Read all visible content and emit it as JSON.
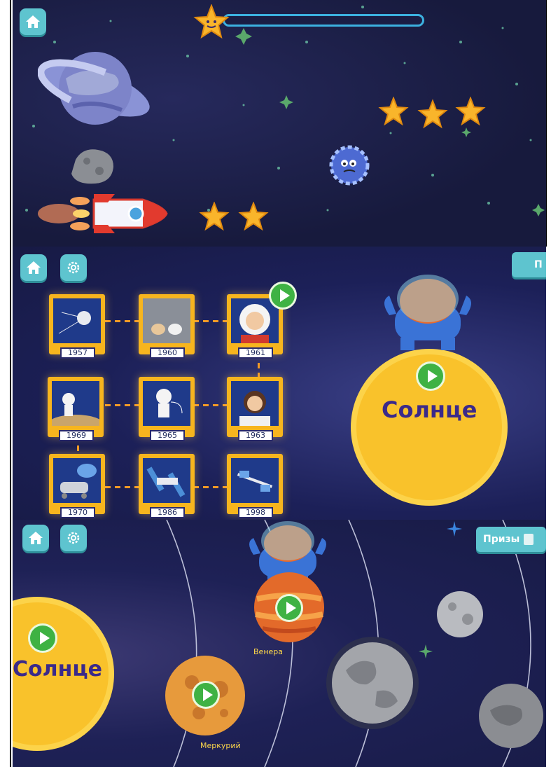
{
  "game_screen": {
    "home_icon": "home-icon",
    "star_count_row": 3,
    "stars_bottom": 2
  },
  "timeline_screen": {
    "home_icon": "home-icon",
    "settings_icon": "gear-icon",
    "prizes_partial": "П",
    "cards": [
      {
        "year": "1957",
        "icon": "sputnik"
      },
      {
        "year": "1960",
        "icon": "space-dogs"
      },
      {
        "year": "1961",
        "icon": "cosmonaut-gagarin"
      },
      {
        "year": "1969",
        "icon": "moon-landing"
      },
      {
        "year": "1965",
        "icon": "spacewalk"
      },
      {
        "year": "1963",
        "icon": "female-cosmonaut"
      },
      {
        "year": "1970",
        "icon": "lunokhod"
      },
      {
        "year": "1986",
        "icon": "mir-station"
      },
      {
        "year": "1998",
        "icon": "iss"
      }
    ],
    "sun_label": "Солнце"
  },
  "solar_screen": {
    "home_icon": "home-icon",
    "settings_icon": "gear-icon",
    "prizes_label": "Призы",
    "sun_label": "Солнце",
    "planets": [
      {
        "label": "Венера"
      },
      {
        "label": "Меркурий"
      }
    ]
  }
}
